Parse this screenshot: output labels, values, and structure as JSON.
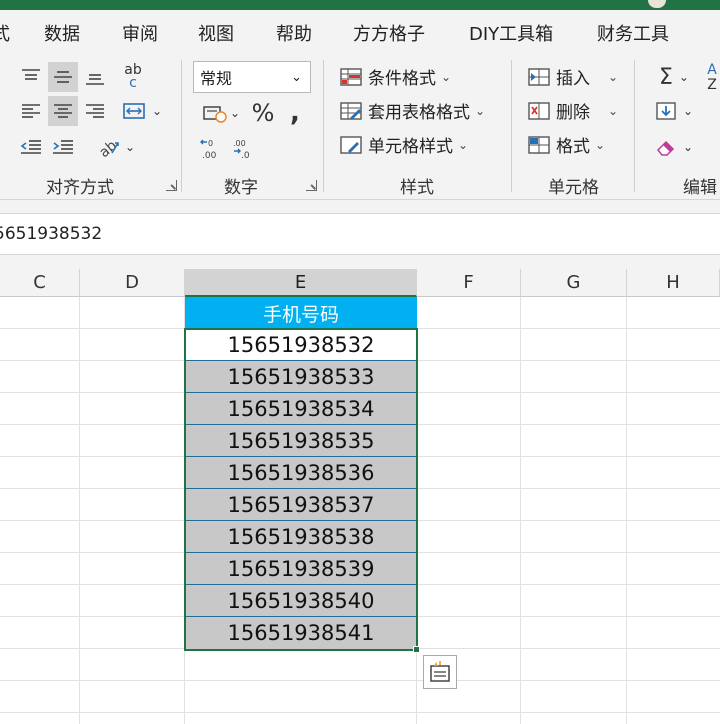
{
  "tabs": [
    "式",
    "数据",
    "审阅",
    "视图",
    "帮助",
    "方方格子",
    "DIY工具箱",
    "财务工具"
  ],
  "ribbon": {
    "alignment": {
      "label": "对齐方式",
      "wrap_glyph": "ab",
      "wrap_glyph2": "c"
    },
    "number": {
      "label": "数字",
      "format_value": "常规",
      "percent": "%",
      "comma": ","
    },
    "styles": {
      "label": "样式",
      "conditional": "条件格式",
      "table": "套用表格格式",
      "cell_style": "单元格样式"
    },
    "cells": {
      "label": "单元格",
      "insert": "插入",
      "delete": "删除",
      "format": "格式"
    },
    "editing": {
      "label": "编辑",
      "sum": "Σ",
      "sort_glyph": "A",
      "sort_glyph2": "Z"
    }
  },
  "formula_bar": {
    "value": "5651938532"
  },
  "columns": [
    "C",
    "D",
    "E",
    "F",
    "G",
    "H"
  ],
  "table": {
    "header": "手机号码",
    "values": [
      "15651938532",
      "15651938533",
      "15651938534",
      "15651938535",
      "15651938536",
      "15651938537",
      "15651938538",
      "15651938539",
      "15651938540",
      "15651938541"
    ]
  },
  "colors": {
    "accent": "#217346",
    "header_fill": "#00b0f0",
    "selection_fill": "#c8c8c8",
    "cell_divider": "#1f6f9c"
  }
}
